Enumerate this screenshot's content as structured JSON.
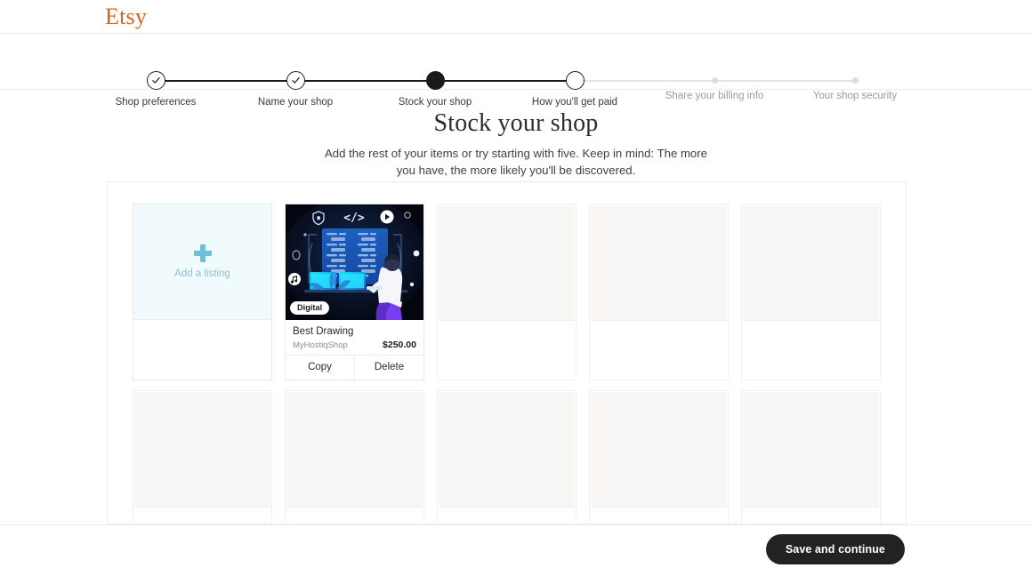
{
  "brand": {
    "logo_text": "Etsy",
    "logo_color": "#d5641c"
  },
  "stepper": {
    "steps": [
      {
        "label": "Shop preferences",
        "state": "completed"
      },
      {
        "label": "Name your shop",
        "state": "completed"
      },
      {
        "label": "Stock your shop",
        "state": "current"
      },
      {
        "label": "How you'll get paid",
        "state": "next"
      },
      {
        "label": "Share your billing info",
        "state": "todo"
      },
      {
        "label": "Your shop security",
        "state": "todo"
      }
    ]
  },
  "page": {
    "title": "Stock your shop",
    "subtitle": "Add the rest of your items or try starting with five. Keep in mind: The more you have, the more likely you'll be discovered."
  },
  "listings": {
    "add_tile": {
      "label": "Add a listing",
      "icon": "plus-icon"
    },
    "items": [
      {
        "name": "Best Drawing",
        "shop": "MyHostiqShop",
        "price": "$250.00",
        "badge": "Digital",
        "copy_label": "Copy",
        "delete_label": "Delete"
      }
    ],
    "empty_slots_row1": 3,
    "empty_slots_row2": 5
  },
  "footer": {
    "save_label": "Save and continue"
  }
}
